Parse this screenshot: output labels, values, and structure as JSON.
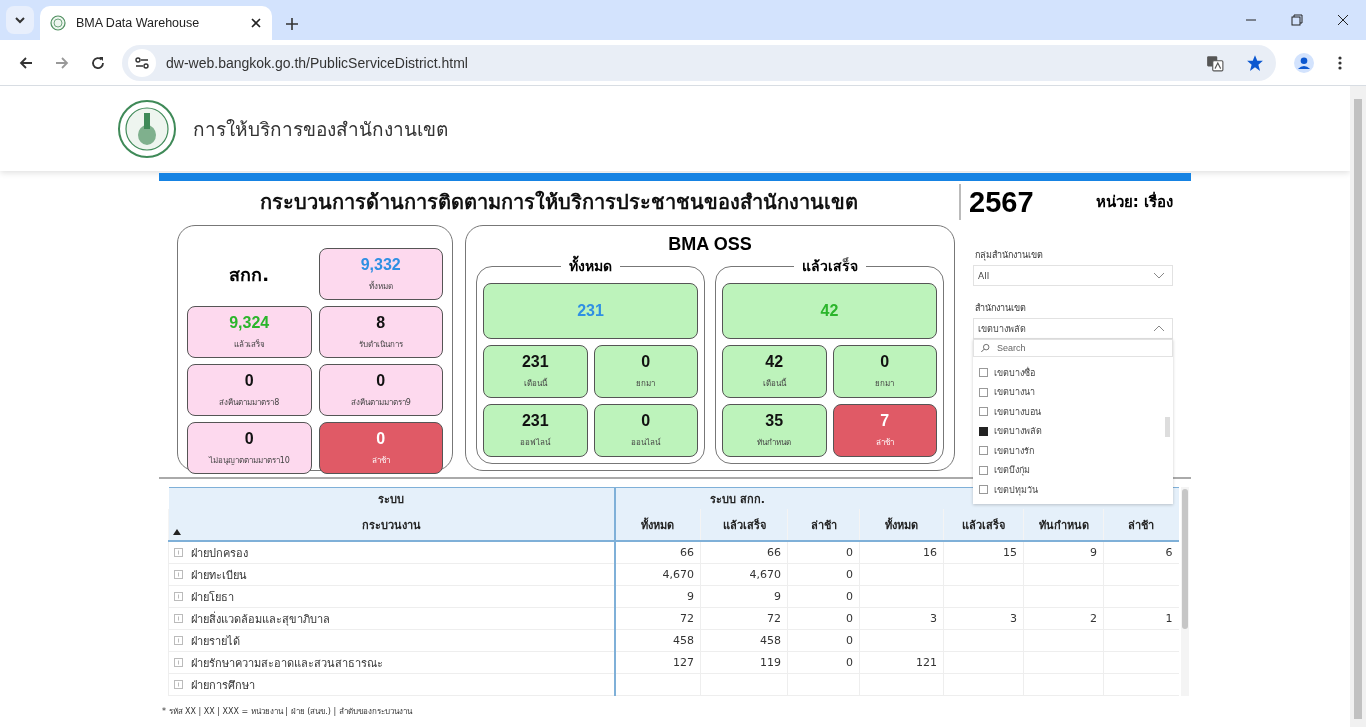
{
  "browser": {
    "tab_title": "BMA Data Warehouse",
    "url": "dw-web.bangkok.go.th/PublicServiceDistrict.html"
  },
  "header": {
    "title": "การให้บริการของสำนักงานเขต"
  },
  "dashboard": {
    "title": "กระบวนการด้านการติดตามการให้บริการประชาชนของสำนักงานเขต",
    "year": "2567",
    "unit": "หน่วย: เรื่อง",
    "skk": {
      "label": "สกก.",
      "tiles": [
        {
          "value": "9,332",
          "caption": "ทั้งหมด",
          "kind": "total"
        },
        {
          "value": "9,324",
          "caption": "แล้วเสร็จ",
          "kind": "done"
        },
        {
          "value": "8",
          "caption": "รับดำเนินการ",
          "kind": "count"
        },
        {
          "value": "0",
          "caption": "ส่งคืนตามมาตรา8",
          "kind": "count"
        },
        {
          "value": "0",
          "caption": "ส่งคืนตามมาตรา9",
          "kind": "count"
        },
        {
          "value": "0",
          "caption": "ไม่อนุญาตตามมาตรา10",
          "kind": "count"
        },
        {
          "value": "0",
          "caption": "ล่าช้า",
          "kind": "late"
        }
      ]
    },
    "oss": {
      "title": "BMA OSS",
      "groups": [
        {
          "title": "ทั้งหมด",
          "tiles": [
            {
              "value": "231",
              "kind": "total"
            },
            {
              "value": "231",
              "caption": "เดือนนี้",
              "kind": "count"
            },
            {
              "value": "0",
              "caption": "ยกมา",
              "kind": "count"
            },
            {
              "value": "231",
              "caption": "ออฟไลน์",
              "kind": "count"
            },
            {
              "value": "0",
              "caption": "ออนไลน์",
              "kind": "count"
            }
          ]
        },
        {
          "title": "แล้วเสร็จ",
          "tiles": [
            {
              "value": "42",
              "kind": "done"
            },
            {
              "value": "42",
              "caption": "เดือนนี้",
              "kind": "count"
            },
            {
              "value": "0",
              "caption": "ยกมา",
              "kind": "count"
            },
            {
              "value": "35",
              "caption": "ทันกำหนด",
              "kind": "count"
            },
            {
              "value": "7",
              "caption": "ล่าช้า",
              "kind": "late"
            }
          ]
        }
      ]
    },
    "filters": [
      {
        "label": "กลุ่มสำนักงานเขต",
        "value": "All",
        "expanded": false
      },
      {
        "label": "สำนักงานเขต",
        "value": "เขตบางพลัด",
        "expanded": true,
        "search_placeholder": "Search",
        "options": [
          {
            "label": "เขตบางซื่อ",
            "checked": false
          },
          {
            "label": "เขตบางนา",
            "checked": false
          },
          {
            "label": "เขตบางบอน",
            "checked": false
          },
          {
            "label": "เขตบางพลัด",
            "checked": true
          },
          {
            "label": "เขตบางรัก",
            "checked": false
          },
          {
            "label": "เขตบึงกุ่ม",
            "checked": false
          },
          {
            "label": "เขตปทุมวัน",
            "checked": false
          }
        ]
      }
    ]
  },
  "table": {
    "group_headers": [
      "ระบบ",
      "ระบบ สกก."
    ],
    "columns": [
      {
        "label": "กระบวนงาน",
        "sorted": true
      },
      {
        "label": "ทั้งหมด",
        "sorted": false
      },
      {
        "label": "แล้วเสร็จ",
        "sorted": false
      },
      {
        "label": "ล่าช้า",
        "sorted": false
      },
      {
        "label": "ทั้งหมด",
        "sorted": false
      },
      {
        "label": "แล้วเสร็จ",
        "sorted": false
      },
      {
        "label": "ทันกำหนด",
        "sorted": false
      },
      {
        "label": "ล่าช้า",
        "sorted": false
      }
    ],
    "rows": [
      {
        "cells": [
          "ฝ่ายปกครอง",
          "66",
          "66",
          "0",
          "16",
          "15",
          "9",
          "6"
        ]
      },
      {
        "cells": [
          "ฝ่ายทะเบียน",
          "4,670",
          "4,670",
          "0",
          "",
          "",
          "",
          ""
        ]
      },
      {
        "cells": [
          "ฝ่ายโยธา",
          "9",
          "9",
          "0",
          "",
          "",
          "",
          ""
        ]
      },
      {
        "cells": [
          "ฝ่ายสิ่งแวดล้อมและสุขาภิบาล",
          "72",
          "72",
          "0",
          "3",
          "3",
          "2",
          "1"
        ]
      },
      {
        "cells": [
          "ฝ่ายรายได้",
          "458",
          "458",
          "0",
          "",
          "",
          "",
          ""
        ]
      },
      {
        "cells": [
          "ฝ่ายรักษาความสะอาดและสวนสาธารณะ",
          "127",
          "119",
          "0",
          "121",
          "",
          "",
          ""
        ]
      },
      {
        "cells": [
          "ฝ่ายการศึกษา",
          "",
          "",
          "",
          "",
          "",
          "",
          ""
        ]
      }
    ]
  },
  "footnote": "* รหัส XX | XX | XXX = หน่วยงาน | ฝ่าย (สนข.) | ลำดับของกระบวนงาน"
}
